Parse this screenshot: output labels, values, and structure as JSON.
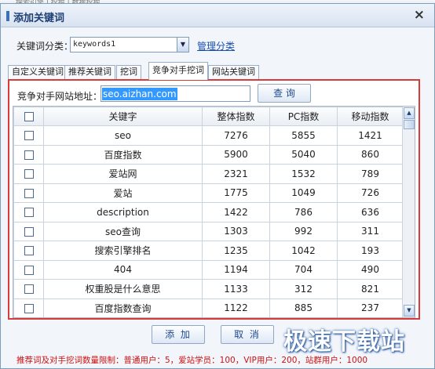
{
  "background_text": "搜索引擎 | 挖掘 | 数据挖掘",
  "dialog": {
    "title": "添加关键词",
    "close_glyph": "×"
  },
  "category": {
    "label": "关键词分类：",
    "value": "keywords1",
    "manage_link": "管理分类"
  },
  "tabs": [
    {
      "label": "自定义关键词"
    },
    {
      "label": "推荐关键词"
    },
    {
      "label": "挖词"
    },
    {
      "label": "竞争对手挖词",
      "active": true
    },
    {
      "label": "网站关键词"
    }
  ],
  "competitor": {
    "url_label": "竞争对手网站地址：",
    "url_value": "seo.aizhan.com",
    "query_button": "查 询"
  },
  "table": {
    "headers": [
      "关键字",
      "整体指数",
      "PC指数",
      "移动指数"
    ],
    "rows": [
      [
        "seo",
        "7276",
        "5855",
        "1421"
      ],
      [
        "百度指数",
        "5900",
        "5040",
        "860"
      ],
      [
        "爱站网",
        "2321",
        "1532",
        "789"
      ],
      [
        "爱站",
        "1775",
        "1049",
        "726"
      ],
      [
        "description",
        "1422",
        "786",
        "636"
      ],
      [
        "seo查询",
        "1303",
        "992",
        "311"
      ],
      [
        "搜索引擎排名",
        "1235",
        "1042",
        "193"
      ],
      [
        "404",
        "1194",
        "704",
        "490"
      ],
      [
        "权重股是什么意思",
        "1133",
        "312",
        "821"
      ],
      [
        "百度指数查询",
        "1122",
        "885",
        "237"
      ]
    ]
  },
  "buttons": {
    "add": "添 加",
    "cancel": "取 消"
  },
  "notice": "推荐词及对手挖词数量限制：普通用户：5，爱站学员：100，VIP用户：200，站群用户：1000",
  "watermark": "极速下载站",
  "colors": {
    "panel_border": "#d93a3a",
    "notice": "#cc1111",
    "link": "#1a4fb0",
    "selection": "#3399ff"
  },
  "icons": {
    "close": "close-icon",
    "dropdown": "chevron-down-icon",
    "scroll_up": "arrow-up-icon",
    "scroll_down": "arrow-down-icon"
  }
}
